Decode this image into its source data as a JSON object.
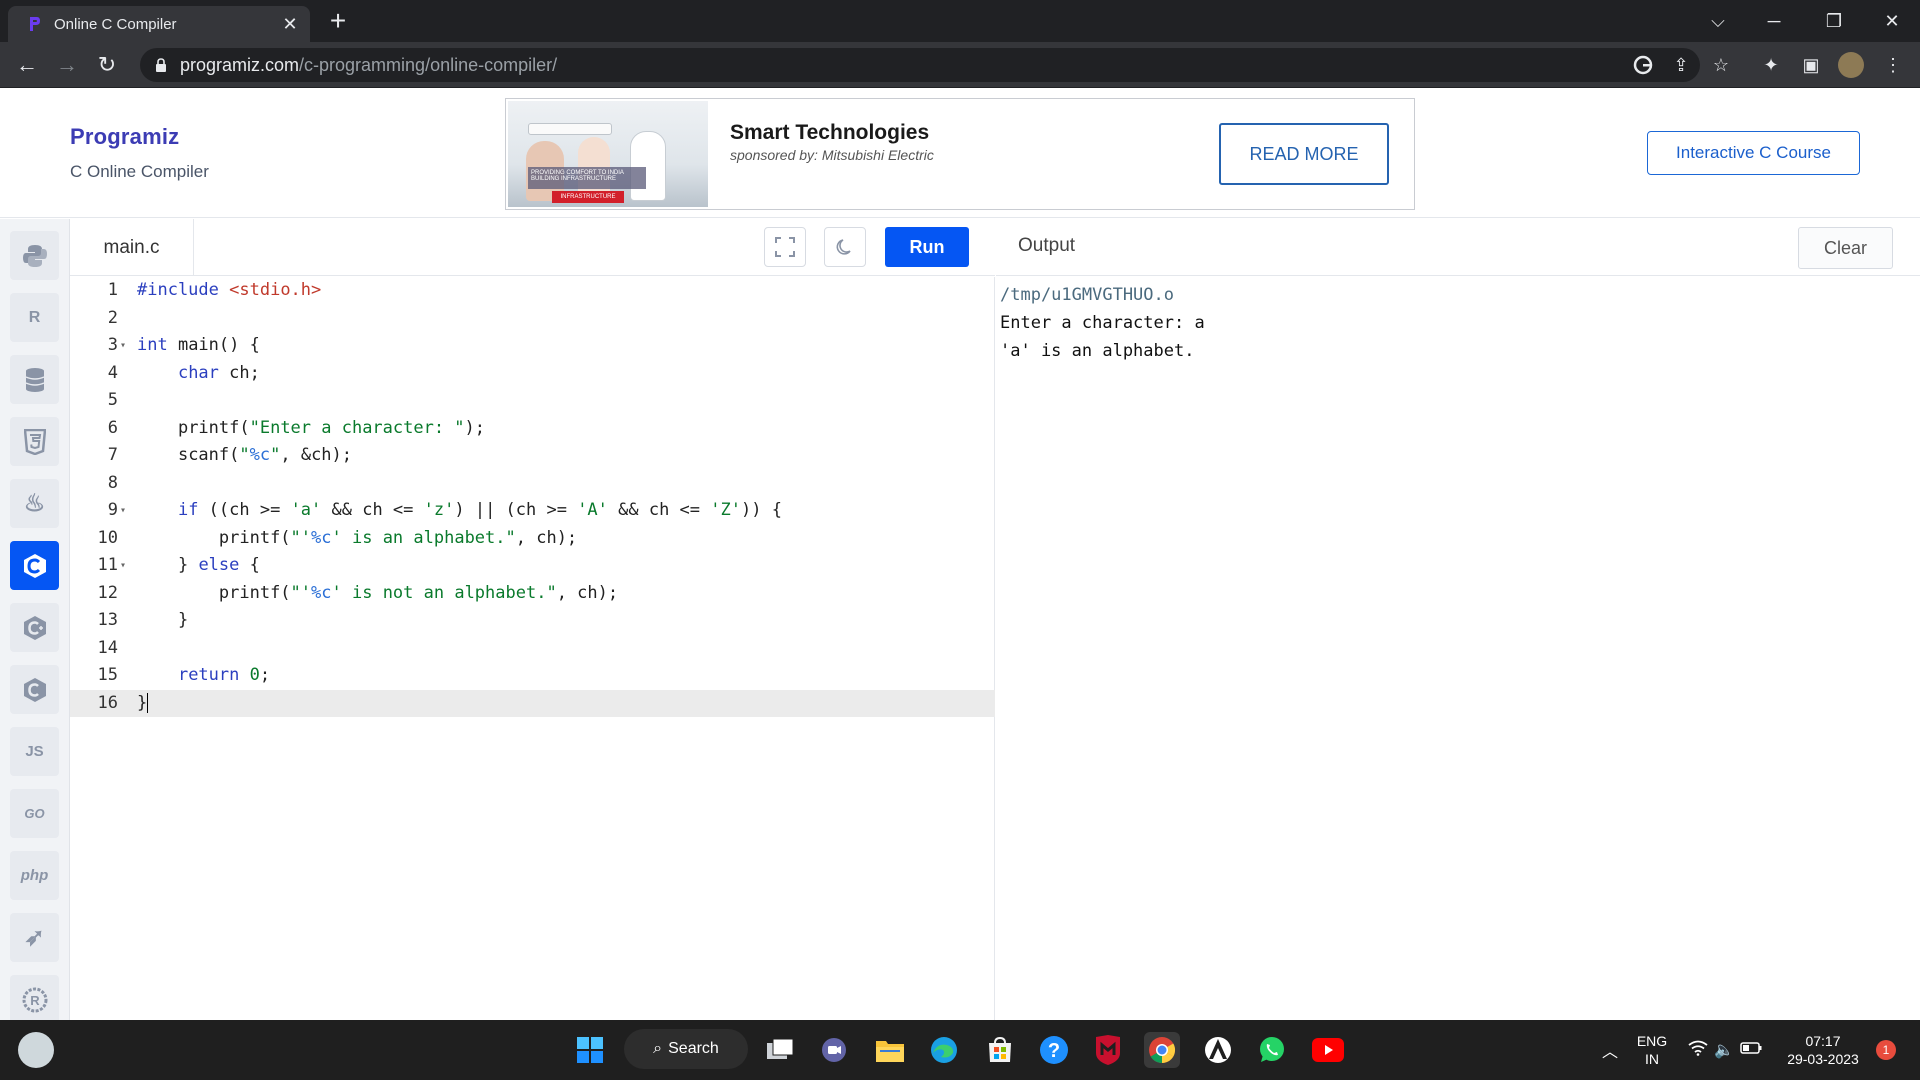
{
  "browser": {
    "tab_title": "Online C Compiler",
    "tab_close": "✕",
    "new_tab": "+",
    "url_domain": "programiz.com",
    "url_path": "/c-programming/online-compiler/"
  },
  "site": {
    "logo_text": "Programiz",
    "subtitle": "C Online Compiler",
    "ad": {
      "title": "Smart Technologies",
      "sponsor": "sponsored by: Mitsubishi Electric",
      "button": "READ MORE",
      "image_caption": "PROVIDING COMFORT TO INDIA BUILDING INFRASTRUCTURE",
      "image_tag": "INFRASTRUCTURE"
    },
    "course_button": "Interactive C Course"
  },
  "sidebar": {
    "languages": [
      {
        "name": "python",
        "glyph": "🐍"
      },
      {
        "name": "r",
        "glyph": "R"
      },
      {
        "name": "sql",
        "glyph": "≡"
      },
      {
        "name": "html",
        "glyph": "5"
      },
      {
        "name": "java",
        "glyph": "♨"
      },
      {
        "name": "c",
        "glyph": "C",
        "active": true
      },
      {
        "name": "cpp",
        "glyph": "C"
      },
      {
        "name": "csharp",
        "glyph": "C"
      },
      {
        "name": "javascript",
        "glyph": "JS"
      },
      {
        "name": "go",
        "glyph": "GO"
      },
      {
        "name": "php",
        "glyph": "php"
      },
      {
        "name": "swift",
        "glyph": "➶"
      },
      {
        "name": "rust",
        "glyph": "R"
      }
    ]
  },
  "editor": {
    "file_name": "main.c",
    "run_label": "Run",
    "lines": [
      {
        "n": "1",
        "fold": ""
      },
      {
        "n": "2",
        "fold": ""
      },
      {
        "n": "3",
        "fold": "▾"
      },
      {
        "n": "4",
        "fold": ""
      },
      {
        "n": "5",
        "fold": ""
      },
      {
        "n": "6",
        "fold": ""
      },
      {
        "n": "7",
        "fold": ""
      },
      {
        "n": "8",
        "fold": ""
      },
      {
        "n": "9",
        "fold": "▾"
      },
      {
        "n": "10",
        "fold": ""
      },
      {
        "n": "11",
        "fold": "▾"
      },
      {
        "n": "12",
        "fold": ""
      },
      {
        "n": "13",
        "fold": ""
      },
      {
        "n": "14",
        "fold": ""
      },
      {
        "n": "15",
        "fold": ""
      },
      {
        "n": "16",
        "fold": ""
      }
    ],
    "code": {
      "l1_kw": "#include",
      "l1_inc": "<stdio.h>",
      "l3_kw": "int",
      "l3_rest": " main() {",
      "l4_kw": "char",
      "l4_rest": " ch;",
      "l6_a": "printf(",
      "l6_str": "\"Enter a character: \"",
      "l6_b": ");",
      "l7_a": "scanf(",
      "l7_q1": "\"",
      "l7_fmt": "%c",
      "l7_q2": "\"",
      "l7_b": ", &ch);",
      "l9_kw": "if",
      "l9_a": " ((ch >= ",
      "l9_s1": "'a'",
      "l9_b": " && ch <= ",
      "l9_s2": "'z'",
      "l9_c": ") || (ch >= ",
      "l9_s3": "'A'",
      "l9_d": " && ch <= ",
      "l9_s4": "'Z'",
      "l9_e": ")) {",
      "l10_a": "printf(",
      "l10_s1": "\"'",
      "l10_fmt": "%c",
      "l10_s2": "' is an alphabet.\"",
      "l10_b": ", ch);",
      "l11_a": "} ",
      "l11_kw": "else",
      "l11_b": " {",
      "l12_a": "printf(",
      "l12_s1": "\"'",
      "l12_fmt": "%c",
      "l12_s2": "' is not an alphabet.\"",
      "l12_b": ", ch);",
      "l13": "}",
      "l15_kw": "return",
      "l15_num": "0",
      "l15_b": ";",
      "l16": "}"
    }
  },
  "output": {
    "label": "Output",
    "clear_label": "Clear",
    "lines": [
      "/tmp/u1GMVGTHUO.o",
      "Enter a character: a",
      "'a' is an alphabet."
    ]
  },
  "taskbar": {
    "search_label": "Search",
    "lang_top": "ENG",
    "lang_bottom": "IN",
    "time": "07:17",
    "date": "29-03-2023",
    "notification_count": "1"
  }
}
